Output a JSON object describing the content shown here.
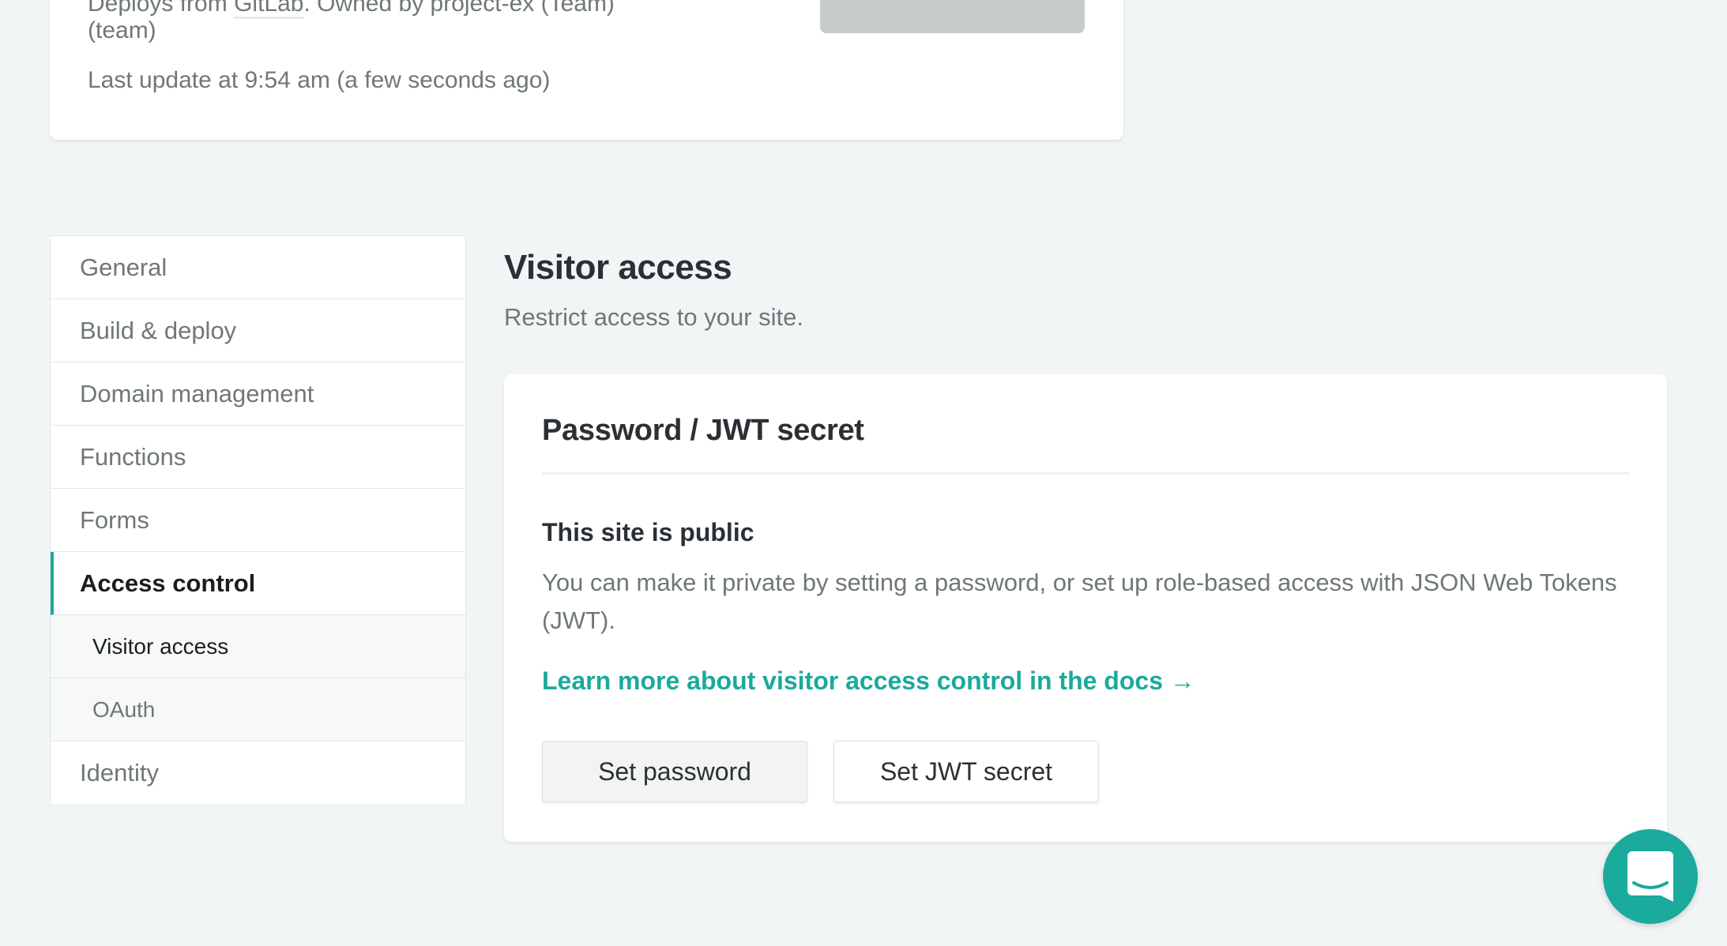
{
  "site_card": {
    "deploy_prefix": "Deploys from ",
    "deploy_source": "GitLab",
    "deploy_suffix": ". Owned by project-ex (Team)",
    "owner_line2": "(team)",
    "last_update": "Last update at 9:54 am (a few seconds ago)"
  },
  "sidebar": {
    "items": [
      {
        "label": "General"
      },
      {
        "label": "Build & deploy"
      },
      {
        "label": "Domain management"
      },
      {
        "label": "Functions"
      },
      {
        "label": "Forms"
      },
      {
        "label": "Access control"
      },
      {
        "label": "Visitor access"
      },
      {
        "label": "OAuth"
      },
      {
        "label": "Identity"
      }
    ]
  },
  "main": {
    "title": "Visitor access",
    "subtitle": "Restrict access to your site.",
    "card": {
      "title": "Password / JWT secret",
      "status": "This site is public",
      "description": "You can make it private by setting a password, or set up role-based access with JSON Web Tokens (JWT).",
      "docs_link": "Learn more about visitor access control in the docs →",
      "set_password": "Set password",
      "set_jwt": "Set JWT secret"
    }
  },
  "colors": {
    "accent": "#1ba99c"
  }
}
